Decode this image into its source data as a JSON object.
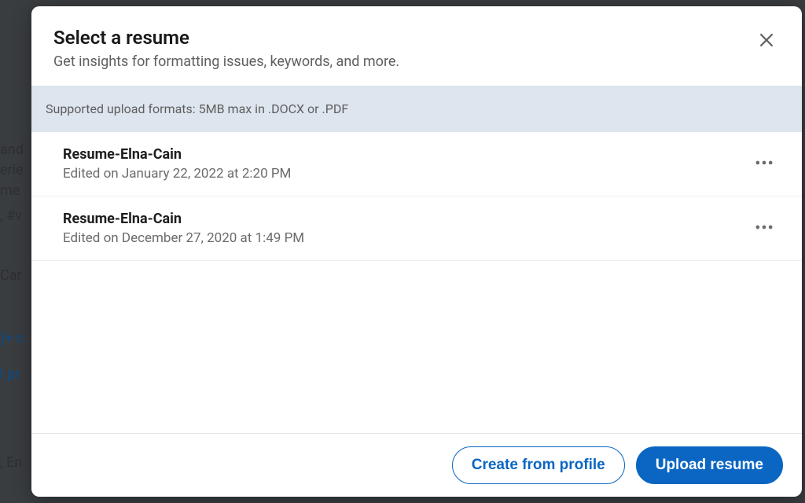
{
  "modal": {
    "title": "Select a resume",
    "subtitle": "Get insights for formatting issues, keywords, and more.",
    "info_banner": "Supported upload formats: 5MB max in .DOCX or .PDF"
  },
  "resumes": [
    {
      "name": "Resume-Elna-Cain",
      "edited": "Edited on January 22, 2022 at 2:20 PM"
    },
    {
      "name": "Resume-Elna-Cain",
      "edited": "Edited on December 27, 2020 at 1:49 PM"
    }
  ],
  "footer": {
    "create_label": "Create from profile",
    "upload_label": "Upload resume"
  }
}
